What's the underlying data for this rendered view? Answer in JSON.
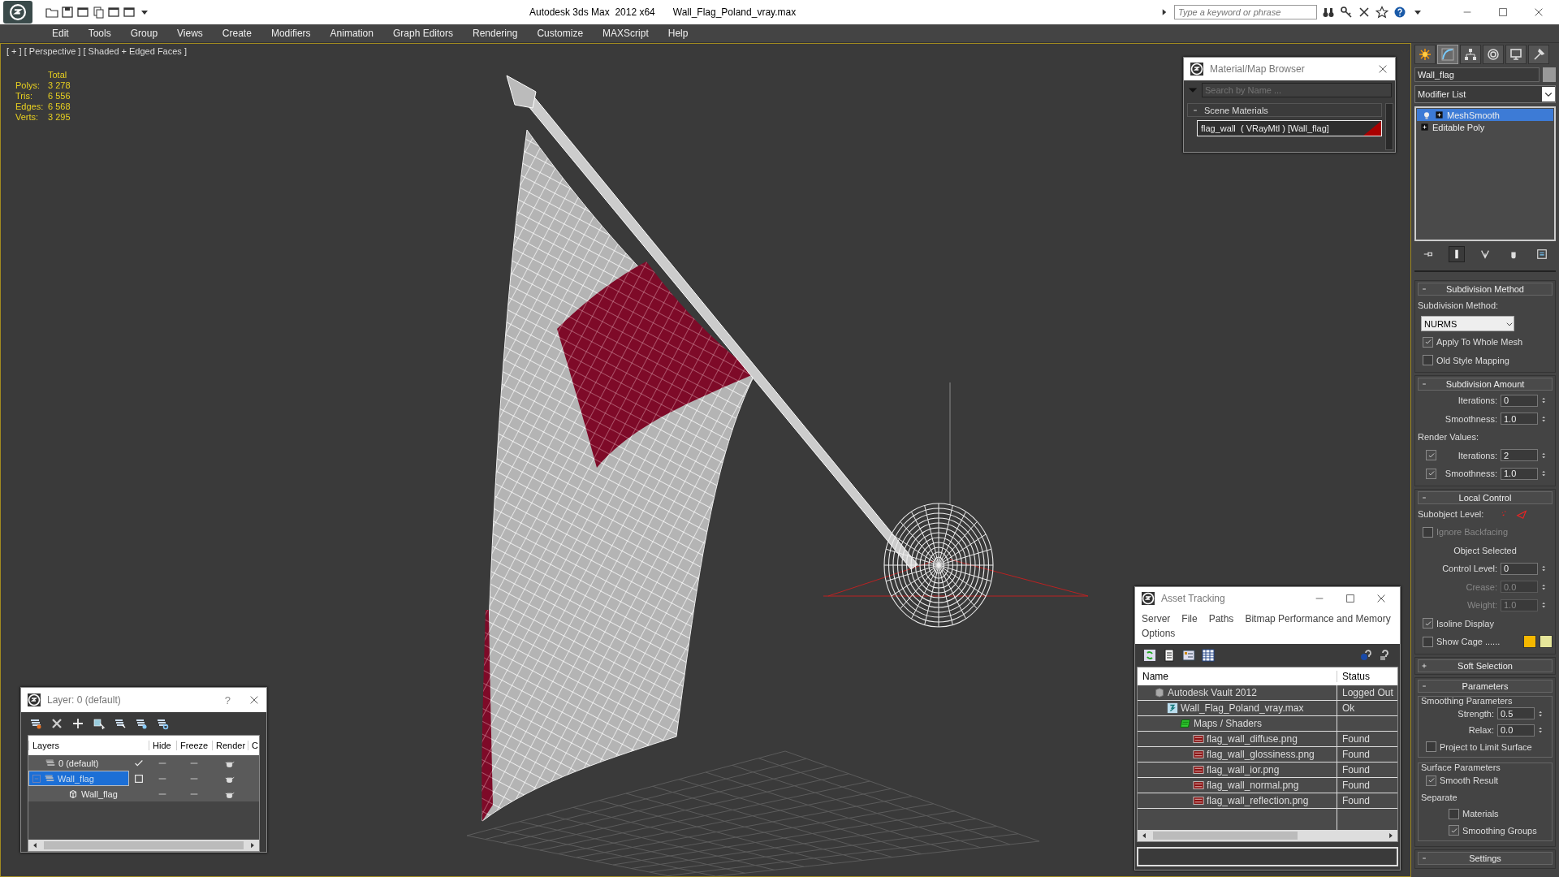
{
  "window": {
    "title": "Autodesk 3ds Max  2012 x64",
    "file": "Wall_Flag_Poland_vray.max",
    "search": {
      "placeholder": "Type a keyword or phrase"
    }
  },
  "menu": [
    "Edit",
    "Tools",
    "Group",
    "Views",
    "Create",
    "Modifiers",
    "Animation",
    "Graph Editors",
    "Rendering",
    "Customize",
    "MAXScript",
    "Help"
  ],
  "viewport": {
    "label": "[ + ] [ Perspective ] [ Shaded + Edged Faces ]",
    "stats_header": "Total",
    "stats": [
      {
        "label": "Polys:",
        "value": "3 278"
      },
      {
        "label": "Tris:",
        "value": "6 556"
      },
      {
        "label": "Edges:",
        "value": "6 568"
      },
      {
        "label": "Verts:",
        "value": "3 295"
      }
    ]
  },
  "material_browser": {
    "title": "Material/Map Browser",
    "search": {
      "placeholder": "Search by Name ..."
    },
    "groups": [
      {
        "title": "Scene Materials",
        "expanded": true,
        "items": [
          {
            "name": "flag_wall  ( VRayMtl ) [Wall_flag]",
            "selected": true
          }
        ]
      }
    ]
  },
  "layer_dialog": {
    "title": "Layer: 0 (default)",
    "help": "?",
    "columns": [
      "Layers",
      "Hide",
      "Freeze",
      "Render",
      "C"
    ],
    "rows": [
      {
        "kind": "layer",
        "name": "0 (default)",
        "current": true,
        "selected": false
      },
      {
        "kind": "layer",
        "name": "Wall_flag",
        "current": false,
        "selected": true,
        "expanded": true,
        "children": [
          {
            "kind": "object",
            "name": "Wall_flag",
            "selected": false
          }
        ]
      }
    ]
  },
  "asset_tracking": {
    "title": "Asset Tracking",
    "menu": [
      "Server",
      "File",
      "Paths",
      "Bitmap Performance and Memory",
      "Options"
    ],
    "columns": [
      "Name",
      "Status"
    ],
    "rows": [
      {
        "kind": "vault",
        "name": "Autodesk Vault 2012",
        "status": "Logged Out",
        "children": [
          {
            "kind": "max",
            "name": "Wall_Flag_Poland_vray.max",
            "status": "Ok",
            "children": [
              {
                "kind": "folder",
                "name": "Maps / Shaders",
                "children": [
                  {
                    "kind": "png",
                    "name": "flag_wall_diffuse.png",
                    "status": "Found"
                  },
                  {
                    "kind": "png",
                    "name": "flag_wall_glossiness.png",
                    "status": "Found"
                  },
                  {
                    "kind": "png",
                    "name": "flag_wall_ior.png",
                    "status": "Found"
                  },
                  {
                    "kind": "png",
                    "name": "flag_wall_normal.png",
                    "status": "Found"
                  },
                  {
                    "kind": "png",
                    "name": "flag_wall_reflection.png",
                    "status": "Found"
                  }
                ]
              }
            ]
          }
        ]
      }
    ]
  },
  "command_panel": {
    "tabs": [
      {
        "kind": "create",
        "selected": false
      },
      {
        "kind": "modify",
        "selected": true
      },
      {
        "kind": "hierarchy",
        "selected": false
      },
      {
        "kind": "motion",
        "selected": false
      },
      {
        "kind": "display",
        "selected": false
      },
      {
        "kind": "utilities",
        "selected": false
      }
    ],
    "object_name": "Wall_flag",
    "modifier_list": "Modifier List",
    "stack": [
      {
        "name": "MeshSmooth",
        "selected": true,
        "kind": "modifier"
      },
      {
        "name": "Editable Poly",
        "selected": false,
        "kind": "base"
      }
    ],
    "stack_tools": [
      {
        "kind": "pin",
        "selected": false
      },
      {
        "kind": "bar",
        "selected": true
      },
      {
        "kind": "fork",
        "selected": false
      },
      {
        "kind": "cup",
        "selected": false
      },
      {
        "kind": "config",
        "selected": false
      }
    ],
    "rollouts": [
      {
        "title": "Subdivision Method",
        "expanded": true,
        "rows": [
          {
            "kind": "label",
            "text": "Subdivision Method:"
          },
          {
            "kind": "dropdown",
            "value": "NURMS"
          },
          {
            "kind": "checkbox",
            "label": "Apply To Whole Mesh",
            "checked": true,
            "disabled": false
          },
          {
            "kind": "checkbox",
            "label": "Old Style Mapping",
            "checked": false,
            "disabled": false
          }
        ]
      },
      {
        "title": "Subdivision Amount",
        "expanded": true,
        "rows": [
          {
            "kind": "spinner",
            "label": "Iterations:",
            "value": "0",
            "disabled": false
          },
          {
            "kind": "spinner",
            "label": "Smoothness:",
            "value": "1.0",
            "disabled": false
          },
          {
            "kind": "label",
            "text": "Render Values:"
          },
          {
            "kind": "checkspinner",
            "label": "Iterations:",
            "value": "2",
            "checked": true,
            "disabled": false
          },
          {
            "kind": "checkspinner",
            "label": "Smoothness:",
            "value": "1.0",
            "checked": true,
            "disabled": false
          }
        ]
      },
      {
        "title": "Local Control",
        "expanded": true,
        "rows": [
          {
            "kind": "subobject",
            "text": "Subobject Level:"
          },
          {
            "kind": "checkbox",
            "label": "Ignore Backfacing",
            "checked": false,
            "disabled": true
          },
          {
            "kind": "center",
            "text": "Object Selected"
          },
          {
            "kind": "spinner",
            "label": "Control Level:",
            "value": "0",
            "disabled": false
          },
          {
            "kind": "spinner",
            "label": "Crease:",
            "value": "0.0",
            "disabled": true
          },
          {
            "kind": "spinner",
            "label": "Weight:",
            "value": "1.0",
            "disabled": true
          },
          {
            "kind": "checkbox",
            "label": "Isoline Display",
            "checked": true,
            "disabled": false
          },
          {
            "kind": "cage",
            "label": "Show Cage ......",
            "checked": false
          }
        ]
      },
      {
        "title": "Soft Selection",
        "expanded": false
      },
      {
        "title": "Parameters",
        "expanded": true,
        "rows": [
          {
            "kind": "group",
            "title": "Smoothing Parameters",
            "rows": [
              {
                "kind": "spinner",
                "label": "Strength:",
                "value": "0.5",
                "disabled": false
              },
              {
                "kind": "spinner",
                "label": "Relax:",
                "value": "0.0",
                "disabled": false
              },
              {
                "kind": "checkbox",
                "label": "Project to Limit Surface",
                "checked": false,
                "disabled": false
              }
            ]
          },
          {
            "kind": "group",
            "title": "Surface Parameters",
            "rows": [
              {
                "kind": "checkbox",
                "label": "Smooth Result",
                "checked": true,
                "disabled": false
              },
              {
                "kind": "label",
                "text": "Separate",
                "children": [
                  {
                    "kind": "checkbox",
                    "label": "Materials",
                    "checked": false,
                    "disabled": false
                  },
                  {
                    "kind": "checkbox",
                    "label": "Smoothing Groups",
                    "checked": true,
                    "disabled": false
                  }
                ]
              }
            ]
          }
        ]
      },
      {
        "title": "Settings",
        "expanded": true
      }
    ]
  }
}
